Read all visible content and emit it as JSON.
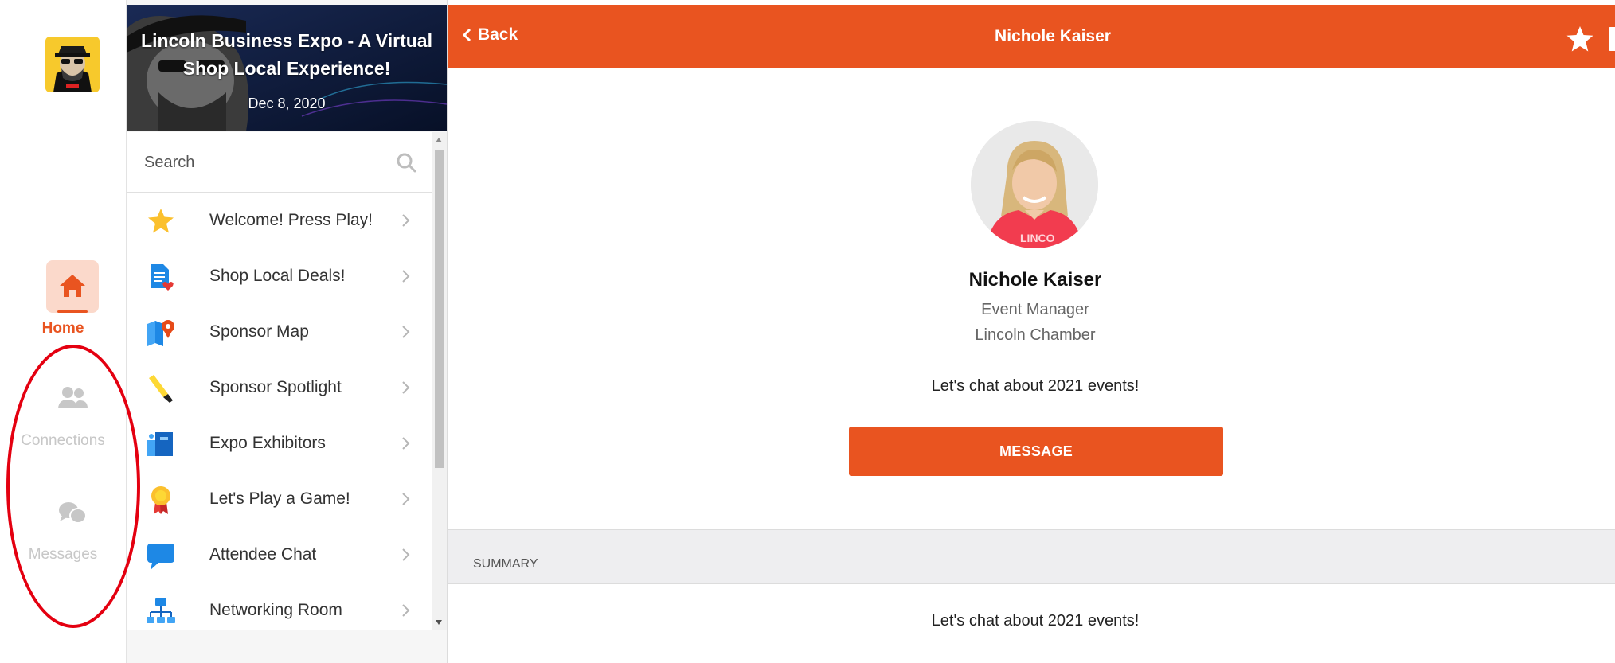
{
  "sidebar": {
    "nav": [
      {
        "label": "Home",
        "icon": "home-icon",
        "active": true
      },
      {
        "label": "Connections",
        "icon": "people-icon",
        "active": false
      },
      {
        "label": "Messages",
        "icon": "chat-bubbles-icon",
        "active": false
      }
    ]
  },
  "event": {
    "title": "Lincoln Business Expo - A Virtual Shop Local Experience!",
    "date": "Dec 8, 2020"
  },
  "search": {
    "placeholder": "Search"
  },
  "menu": {
    "items": [
      {
        "label": "Welcome! Press Play!",
        "icon": "star-icon"
      },
      {
        "label": "Shop Local Deals!",
        "icon": "document-heart-icon"
      },
      {
        "label": "Sponsor Map",
        "icon": "map-pin-icon"
      },
      {
        "label": "Sponsor Spotlight",
        "icon": "flashlight-icon"
      },
      {
        "label": "Expo Exhibitors",
        "icon": "booth-icon"
      },
      {
        "label": "Let's Play a Game!",
        "icon": "award-ribbon-icon"
      },
      {
        "label": "Attendee Chat",
        "icon": "speech-bubble-icon"
      },
      {
        "label": "Networking Room",
        "icon": "network-icon"
      }
    ]
  },
  "header": {
    "back_label": "Back",
    "title": "Nichole Kaiser"
  },
  "profile": {
    "name": "Nichole Kaiser",
    "role": "Event Manager",
    "organization": "Lincoln Chamber",
    "tagline": "Let's chat about 2021 events!",
    "message_button": "MESSAGE"
  },
  "summary": {
    "label": "SUMMARY",
    "text": "Let's chat about 2021 events!"
  },
  "colors": {
    "accent": "#e95420",
    "highlight_circle": "#e40010",
    "inactive_nav": "#c7c7c7"
  }
}
